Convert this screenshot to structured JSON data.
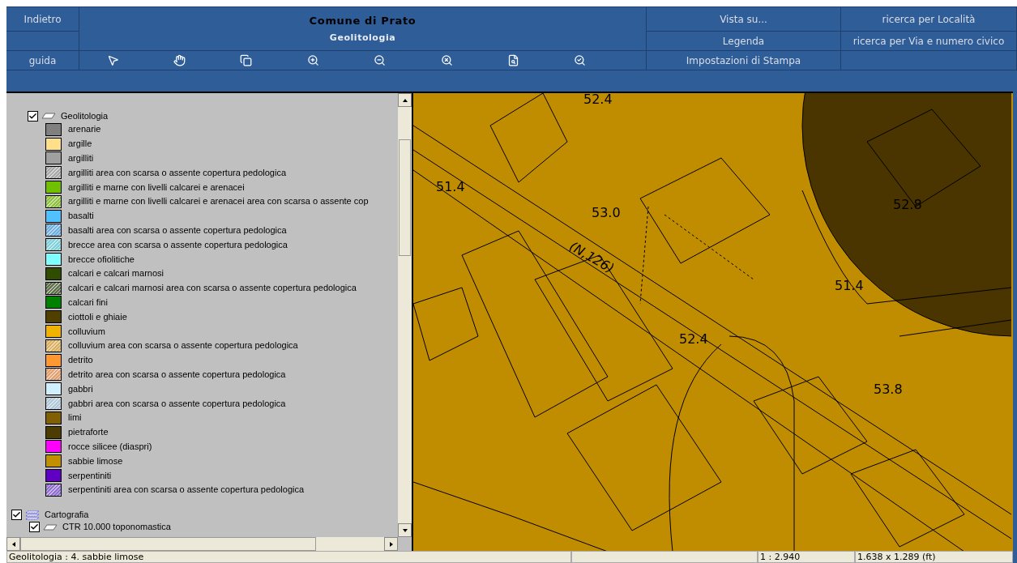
{
  "header": {
    "back": "Indietro",
    "help": "guida",
    "title": "Comune di Prato",
    "subtitle": "Geolitologia",
    "links": [
      [
        "Vista su...",
        "ricerca per Località"
      ],
      [
        "Legenda",
        "ricerca per Via e numero civico"
      ],
      [
        "Impostazioni di Stampa"
      ]
    ]
  },
  "tools": [
    {
      "kind": "select"
    },
    {
      "kind": "pan"
    },
    {
      "kind": "copy"
    },
    {
      "kind": "zoom-in"
    },
    {
      "kind": "zoom-out"
    },
    {
      "kind": "zoom-extent"
    },
    {
      "kind": "identify"
    },
    {
      "kind": "zoom-back"
    }
  ],
  "layers": [
    {
      "label": "Geolitologia",
      "checked": true,
      "kind": "polygon",
      "legend": [
        {
          "label": "arenarie",
          "color": "#808080",
          "hatched": false
        },
        {
          "label": "argille",
          "color": "#ffe08a",
          "hatched": false
        },
        {
          "label": "argilliti",
          "color": "#a0a0a0",
          "hatched": false
        },
        {
          "label": "argilliti area con scarsa o assente copertura pedologica",
          "color": "#a8a8a8",
          "hatched": true
        },
        {
          "label": "argilliti e marne con livelli calcarei e arenacei",
          "color": "#70c000",
          "hatched": false
        },
        {
          "label": "argilliti e marne con livelli calcarei e arenacei area con scarsa o assente cop",
          "color": "#90c040",
          "hatched": true
        },
        {
          "label": "basalti",
          "color": "#50c0ff",
          "hatched": false
        },
        {
          "label": "basalti area con scarsa o assente copertura pedologica",
          "color": "#70b0e0",
          "hatched": true
        },
        {
          "label": "brecce area con scarsa o assente copertura pedologica",
          "color": "#80d0d8",
          "hatched": true
        },
        {
          "label": "brecce ofiolitiche",
          "color": "#80ffff",
          "hatched": false
        },
        {
          "label": "calcari e calcari marnosi",
          "color": "#304c00",
          "hatched": false
        },
        {
          "label": "calcari e calcari marnosi area con scarsa o assente copertura pedologica",
          "color": "#60704c",
          "hatched": true
        },
        {
          "label": "calcari fini",
          "color": "#008000",
          "hatched": false
        },
        {
          "label": "ciottoli e ghiaie",
          "color": "#504000",
          "hatched": false
        },
        {
          "label": "colluvium",
          "color": "#f0b400",
          "hatched": false
        },
        {
          "label": "colluvium area con scarsa o assente copertura pedologica",
          "color": "#d8b060",
          "hatched": true
        },
        {
          "label": "detrito",
          "color": "#ff9830",
          "hatched": false
        },
        {
          "label": "detrito area con scarsa o assente copertura pedologica",
          "color": "#e0a070",
          "hatched": true
        },
        {
          "label": "gabbri",
          "color": "#d0f0ff",
          "hatched": false
        },
        {
          "label": "gabbri area con scarsa o assente copertura pedologica",
          "color": "#b0c8d8",
          "hatched": true
        },
        {
          "label": "limi",
          "color": "#806000",
          "hatched": false
        },
        {
          "label": "pietraforte",
          "color": "#4c3c00",
          "hatched": false
        },
        {
          "label": "rocce silicee (diaspri)",
          "color": "#ff00ff",
          "hatched": false
        },
        {
          "label": "sabbie limose",
          "color": "#c09000",
          "hatched": false
        },
        {
          "label": "serpentiniti",
          "color": "#6000c0",
          "hatched": false
        },
        {
          "label": "serpentiniti area con scarsa o assente copertura pedologica",
          "color": "#9070d0",
          "hatched": true
        }
      ]
    },
    {
      "label": "Cartografia",
      "checked": true,
      "kind": "group",
      "children": [
        {
          "label": "CTR 10.000 toponomastica",
          "checked": true,
          "kind": "polygon"
        }
      ]
    }
  ],
  "map": {
    "labels": [
      "52.4",
      "51.4",
      "53.0",
      "(N,126)",
      "52.8",
      "51.4",
      "52.4",
      "53.8"
    ]
  },
  "status_bar": {
    "message": "Geolitologia : 4. sabbie limose",
    "scale": "1 : 2.940",
    "extent": "1.638 x 1.289 (ft)"
  }
}
